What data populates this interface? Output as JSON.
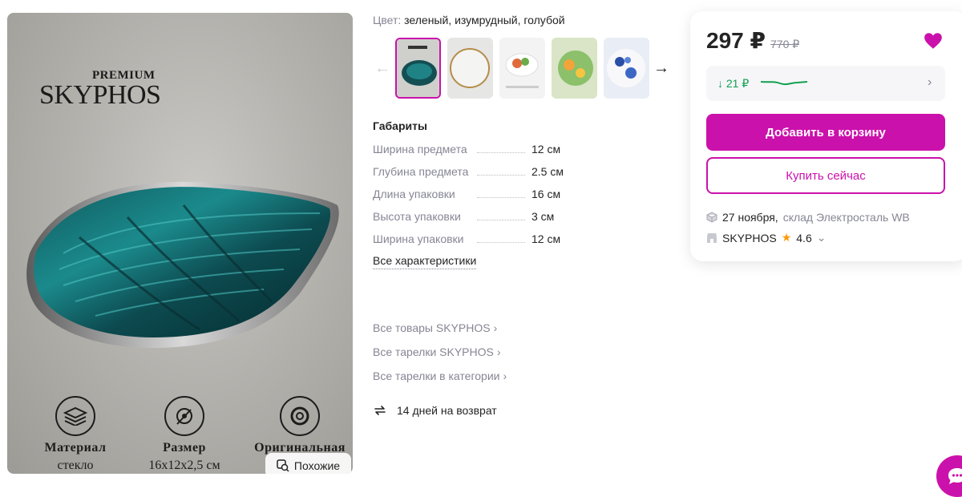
{
  "product_image": {
    "brand_premium": "PREMIUM",
    "brand_name": "SKYPHOS",
    "features": [
      {
        "title": "Материал",
        "value": "стекло",
        "icon": "layers-icon"
      },
      {
        "title": "Размер",
        "value": "16х12х2,5 см",
        "icon": "tape-measure-icon"
      },
      {
        "title": "Оригинальная",
        "value": "",
        "icon": "tape-roll-icon"
      }
    ],
    "similar_label": "Похожие"
  },
  "color": {
    "label": "Цвет:",
    "value": "зеленый, изумрудный, голубой"
  },
  "thumbnails": [
    "thumb-teal-shell",
    "thumb-gold-rim-plate",
    "thumb-food-plate",
    "thumb-green-citrus-plate",
    "thumb-blue-floral-plate"
  ],
  "specs": {
    "title": "Габариты",
    "rows": [
      {
        "key": "Ширина предмета",
        "value": "12 см"
      },
      {
        "key": "Глубина предмета",
        "value": "2.5 см"
      },
      {
        "key": "Длина упаковки",
        "value": "16 см"
      },
      {
        "key": "Высота упаковки",
        "value": "3 см"
      },
      {
        "key": "Ширина упаковки",
        "value": "12 см"
      }
    ],
    "all_label": "Все характеристики"
  },
  "links": [
    "Все товары SKYPHOS",
    "Все тарелки SKYPHOS",
    "Все тарелки в категории"
  ],
  "returns_label": "14 дней на возврат",
  "card": {
    "price": "297 ₽",
    "old_price": "770 ₽",
    "price_drop": "↓ 21 ₽",
    "add_to_cart": "Добавить в корзину",
    "buy_now": "Купить сейчас",
    "delivery_date": "27 ноября,",
    "warehouse": "склад Электросталь WB",
    "seller": "SKYPHOS",
    "rating": "4.6"
  },
  "colors": {
    "accent": "#cb11ab",
    "green": "#11a04f",
    "muted": "#868695",
    "text": "#242424"
  }
}
